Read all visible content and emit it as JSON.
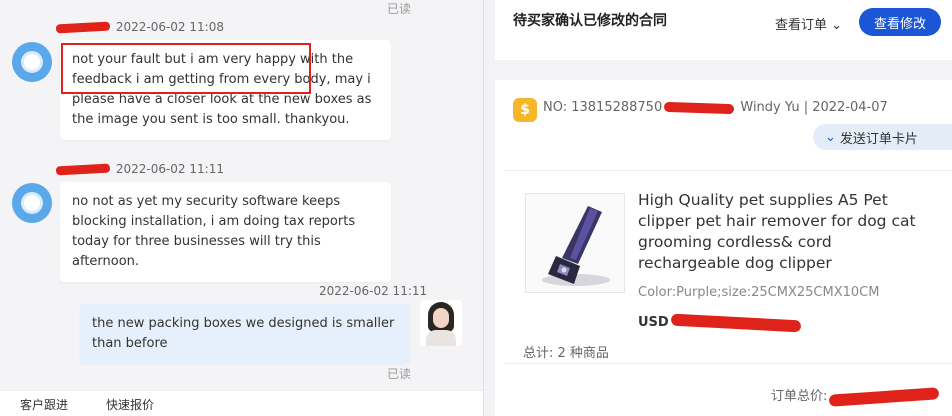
{
  "chat": {
    "read_label": "已读",
    "messages": [
      {
        "time": "2022-06-02 11:08",
        "text": "not your fault but i am very happy with the feedback i am getting from every body, may i please have a closer look at the new boxes as the image you sent is too small. thankyou."
      },
      {
        "time": "2022-06-02 11:11",
        "text": "no not as yet my security software keeps blocking installation, i am doing tax reports today for three businesses will try this afternoon."
      },
      {
        "time": "2022-06-02 11:11",
        "text": "the new packing boxes we designed is smaller than before"
      }
    ],
    "bottom_links": [
      "客户跟进",
      "快速报价"
    ]
  },
  "contract_card": {
    "title": "待买家确认已修改的合同",
    "view_order_label": "查看订单",
    "view_changes_button": "查看修改"
  },
  "order_card": {
    "order_prefix": "NO: 13815288750",
    "buyer_name": "Windy Yu",
    "date": "2022-04-07",
    "send_card_label": "发送订单卡片",
    "product_title": "High Quality pet supplies A5 Pet clipper pet hair remover for dog cat grooming cordless& cord rechargeable dog clipper",
    "product_spec": "Color:Purple;size:25CMX25CMX10CM",
    "currency": "USD",
    "total_items": "总计: 2 种商品",
    "order_total_label": "订单总价:"
  },
  "colors": {
    "accent": "#1a56d6",
    "redaction": "#e0231a",
    "highlight_border": "#e0231a"
  }
}
